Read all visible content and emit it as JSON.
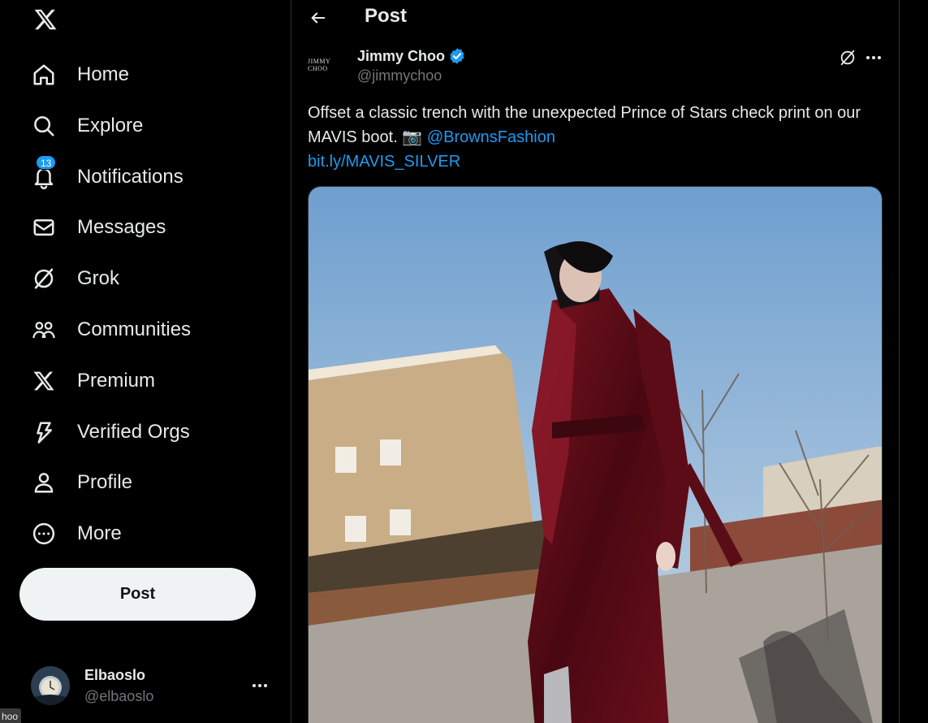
{
  "nav": {
    "items": [
      {
        "label": "Home",
        "icon": "home-icon"
      },
      {
        "label": "Explore",
        "icon": "search-icon"
      },
      {
        "label": "Notifications",
        "icon": "bell-icon",
        "badge": "13"
      },
      {
        "label": "Messages",
        "icon": "mail-icon"
      },
      {
        "label": "Grok",
        "icon": "grok-icon"
      },
      {
        "label": "Communities",
        "icon": "communities-icon"
      },
      {
        "label": "Premium",
        "icon": "x-logo-icon"
      },
      {
        "label": "Verified Orgs",
        "icon": "lightning-icon"
      },
      {
        "label": "Profile",
        "icon": "person-icon"
      },
      {
        "label": "More",
        "icon": "more-circle-icon"
      }
    ],
    "post_button": "Post"
  },
  "account": {
    "display_name": "Elbaoslo",
    "handle": "@elbaoslo"
  },
  "tooltip": "hoo",
  "header": {
    "title": "Post"
  },
  "tweet": {
    "author_name": "Jimmy Choo",
    "author_handle": "@jimmychoo",
    "avatar_text": "JIMMY CHOO",
    "text_main": "Offset a classic trench with the unexpected Prince of Stars check print on our MAVIS boot. 📷 ",
    "mention": "@BrownsFashion",
    "link": "bit.ly/MAVIS_SILVER",
    "media_icon": "photo-of-model-in-burgundy-trench"
  },
  "colors": {
    "background": "#000000",
    "text": "#e7e9ea",
    "muted": "#71767b",
    "accent": "#1d9bf0",
    "border": "#2f3336"
  }
}
